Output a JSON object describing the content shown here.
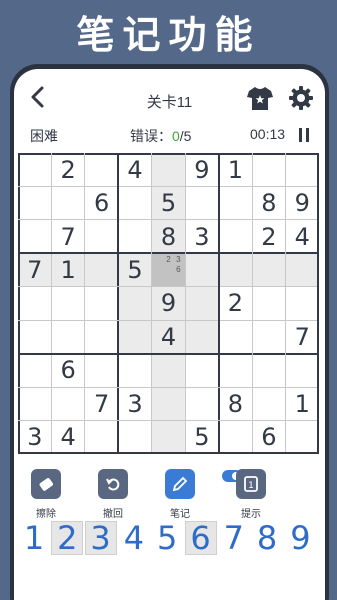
{
  "banner": {
    "title": "笔记功能"
  },
  "header": {
    "level": "关卡11"
  },
  "status": {
    "difficulty": "困难",
    "errors_label": "错误：",
    "errors_count": "0",
    "errors_max": "/5",
    "timer": "00:13"
  },
  "board": {
    "values": [
      [
        "",
        "2",
        "",
        "4",
        "",
        "9",
        "1",
        "",
        ""
      ],
      [
        "",
        "",
        "6",
        "",
        "5",
        "",
        "",
        "8",
        "9"
      ],
      [
        "",
        "7",
        "",
        "",
        "8",
        "3",
        "",
        "2",
        "4"
      ],
      [
        "7",
        "1",
        "",
        "5",
        "",
        "",
        "",
        "",
        ""
      ],
      [
        "",
        "",
        "",
        "",
        "9",
        "",
        "2",
        "",
        ""
      ],
      [
        "",
        "",
        "",
        "",
        "4",
        "",
        "",
        "",
        "7"
      ],
      [
        "",
        "6",
        "",
        "",
        "",
        "",
        "",
        "",
        ""
      ],
      [
        "",
        "",
        "7",
        "3",
        "",
        "",
        "8",
        "",
        "1"
      ],
      [
        "3",
        "4",
        "",
        "",
        "",
        "5",
        "",
        "6",
        ""
      ]
    ],
    "selected": {
      "row": 3,
      "col": 4
    },
    "notes": {
      "row": 3,
      "col": 4,
      "marks": [
        "",
        "2",
        "3",
        "",
        "",
        "6",
        "",
        "",
        ""
      ]
    }
  },
  "tools": [
    {
      "label": "擦除",
      "icon": "eraser-icon"
    },
    {
      "label": "撤回",
      "icon": "undo-icon"
    },
    {
      "label": "笔记",
      "icon": "pencil-icon",
      "active": true
    },
    {
      "label": "提示",
      "icon": "hint-icon"
    }
  ],
  "numpad": [
    {
      "label": "1",
      "used": false
    },
    {
      "label": "2",
      "used": true
    },
    {
      "label": "3",
      "used": true
    },
    {
      "label": "4",
      "used": false
    },
    {
      "label": "5",
      "used": false
    },
    {
      "label": "6",
      "used": true
    },
    {
      "label": "7",
      "used": false
    },
    {
      "label": "8",
      "used": false
    },
    {
      "label": "9",
      "used": false
    }
  ],
  "colors": {
    "background": "#54688a",
    "accent": "#3a7bd5",
    "digit": "#2e6cc8",
    "error_ok": "#3aaa35"
  }
}
